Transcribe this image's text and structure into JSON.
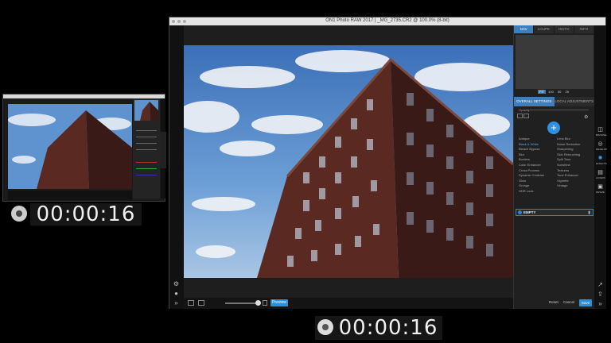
{
  "window": {
    "title": "ON1 Photo RAW 2017 | _MG_2735.CR2 @ 100.0% (8-bit)"
  },
  "panel": {
    "tabs": [
      {
        "label": "NAV"
      },
      {
        "label": "LOUPE"
      },
      {
        "label": "HISTO"
      },
      {
        "label": "INFO"
      }
    ],
    "zoom_options": [
      "FIT",
      "100",
      "50",
      "25"
    ],
    "section_tabs": [
      {
        "label": "OVERALL SETTINGS"
      },
      {
        "label": "LOCAL ADJUSTMENTS"
      }
    ],
    "opacity_label": "Opacity",
    "filters_left": [
      "Antique",
      "Black & White",
      "Bleach Bypass",
      "Blur",
      "Borders",
      "Color Enhancer",
      "Cross Process",
      "Dynamic Contrast",
      "Glow",
      "Grunge",
      "HDR Look"
    ],
    "filters_right": [
      "Lens Blur",
      "Noise Reduction",
      "Sharpening",
      "Skin Retouching",
      "Split Tone",
      "Sunshine",
      "Textures",
      "Tone Enhancer",
      "Vignette",
      "Vintage"
    ],
    "layer_label": "EMPTY",
    "reset_label": "Reset",
    "cancel_label": "Cancel",
    "save_label": "Save"
  },
  "modules": [
    {
      "label": "BROWSE"
    },
    {
      "label": "DEVELOP"
    },
    {
      "label": "EFFECTS"
    },
    {
      "label": "LAYERS"
    },
    {
      "label": "RESIZE"
    }
  ],
  "bottombar": {
    "preview_label": "Preview"
  },
  "timers": {
    "pip_time": "00:00:16",
    "main_time": "00:00:16"
  }
}
